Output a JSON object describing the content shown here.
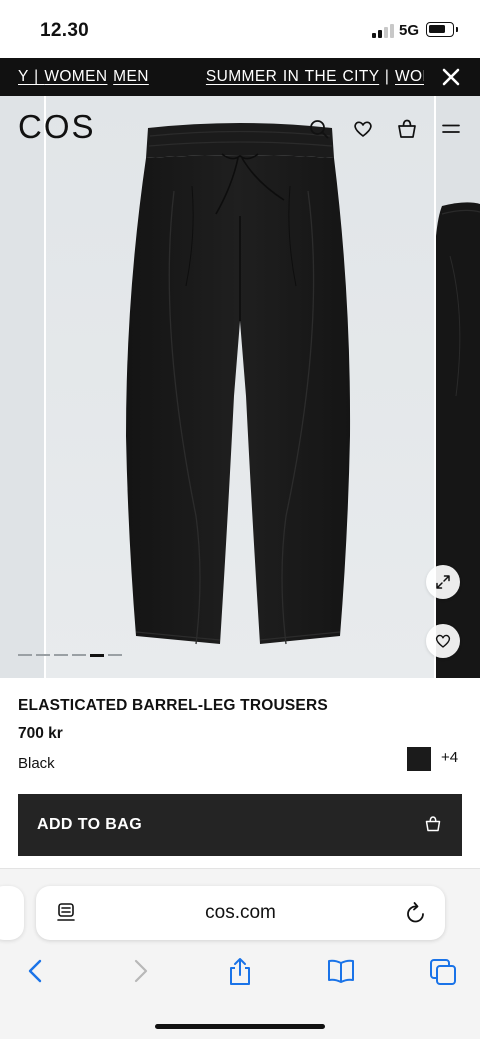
{
  "status_bar": {
    "time": "12.30",
    "network": "5G",
    "signal_icon": "cellular-signal-icon",
    "battery_icon": "battery-icon"
  },
  "promo_banner": {
    "text_start": "Y | ",
    "link_women": "WOMEN",
    "link_men": "MEN",
    "campaign": "SUMMER IN THE CITY",
    "separator": " | ",
    "link_women_repeat": "WOMI",
    "close_icon": "close-icon"
  },
  "header": {
    "brand": "COS",
    "icons": [
      "search-icon",
      "heart-icon",
      "shopping-bag-icon",
      "menu-icon"
    ]
  },
  "gallery": {
    "image_count": 6,
    "active_index": 4,
    "expand_icon": "expand-icon",
    "wishlist_icon": "heart-icon"
  },
  "product": {
    "name": "ELASTICATED BARREL-LEG TROUSERS",
    "price": "700 kr",
    "color": "Black",
    "swatch_color": "#1b1b1b",
    "more_colors": "+4",
    "add_to_bag_label": "ADD TO BAG",
    "add_to_bag_icon": "shopping-bag-icon"
  },
  "browser": {
    "url": "cos.com",
    "reader_icon": "page-menu-icon",
    "reload_icon": "reload-icon",
    "toolbar": [
      "back-icon",
      "forward-icon",
      "share-icon",
      "bookmarks-icon",
      "tabs-icon"
    ],
    "accent_color": "#1a73e8"
  }
}
